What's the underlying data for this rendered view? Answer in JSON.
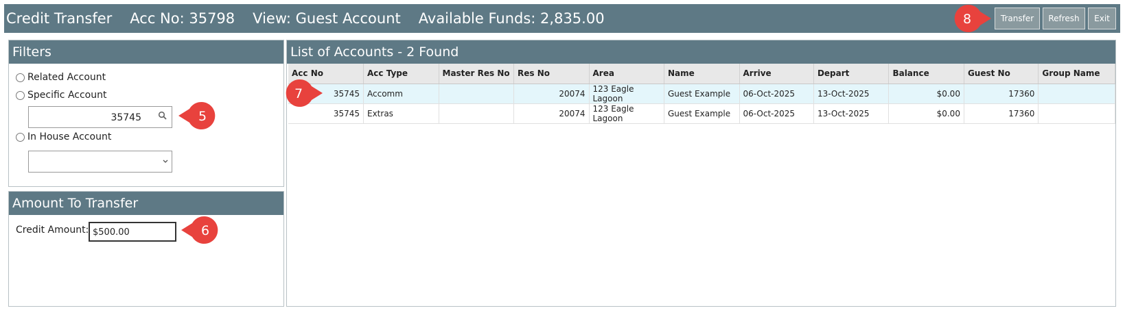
{
  "titlebar": {
    "title": "Credit Transfer",
    "acc_no": "Acc No: 35798",
    "view": "View: Guest Account",
    "funds": "Available Funds: 2,835.00",
    "buttons": {
      "transfer": "Transfer",
      "refresh": "Refresh",
      "exit": "Exit"
    }
  },
  "filters": {
    "heading": "Filters",
    "related": "Related Account",
    "specific": "Specific Account",
    "specific_value": "35745",
    "in_house": "In House Account",
    "in_house_value": ""
  },
  "amount": {
    "heading": "Amount To Transfer",
    "label": "Credit Amount:",
    "value": "$500.00"
  },
  "accounts": {
    "heading": "List of Accounts - 2 Found",
    "columns": [
      "Acc No",
      "Acc Type",
      "Master Res No",
      "Res No",
      "Area",
      "Name",
      "Arrive",
      "Depart",
      "Balance",
      "Guest No",
      "Group Name"
    ],
    "rows": [
      [
        "35745",
        "Accomm",
        "",
        "20074",
        "123 Eagle Lagoon",
        "Guest Example",
        "06-Oct-2025",
        "13-Oct-2025",
        "$0.00",
        "17360",
        ""
      ],
      [
        "35745",
        "Extras",
        "",
        "20074",
        "123 Eagle Lagoon",
        "Guest Example",
        "06-Oct-2025",
        "13-Oct-2025",
        "$0.00",
        "17360",
        ""
      ]
    ]
  },
  "callouts": {
    "c5": "5",
    "c6": "6",
    "c7": "7",
    "c8": "8"
  },
  "colors": {
    "header": "#5e7985",
    "selected_row": "#e4f6fb",
    "callout": "#e8423d"
  },
  "icons": [
    "search-icon",
    "chevron-down-icon"
  ]
}
